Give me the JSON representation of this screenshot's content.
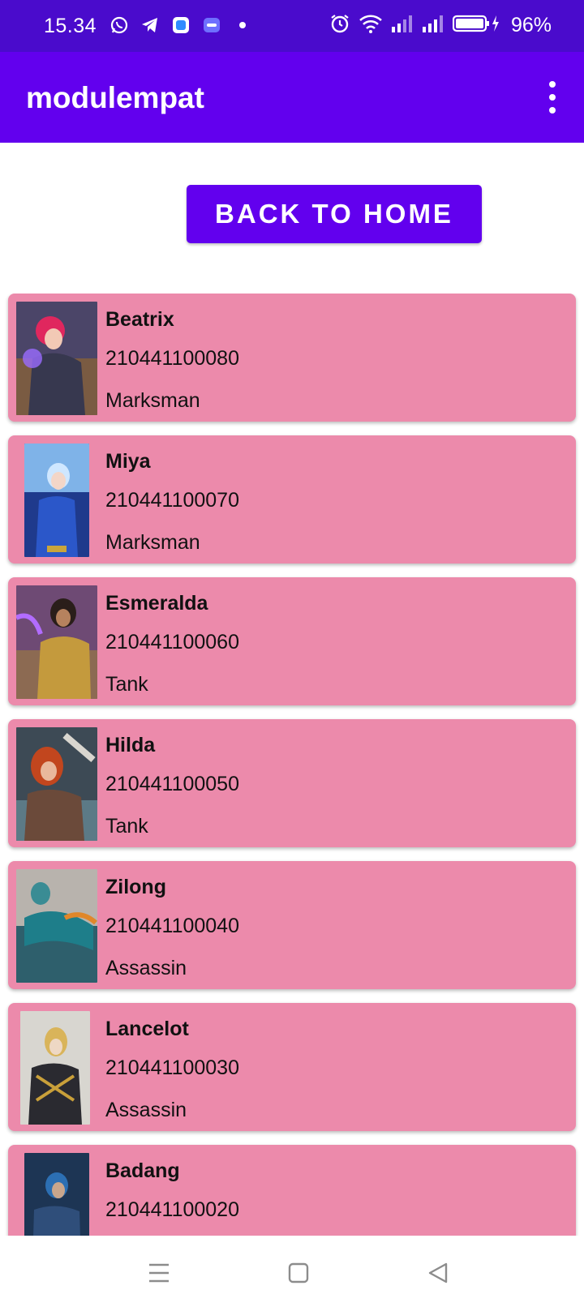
{
  "status_bar": {
    "time": "15.34",
    "battery_percent": "96%",
    "icons_left": [
      "whatsapp-icon",
      "telegram-icon",
      "app-icon",
      "game-icon",
      "dot-icon"
    ],
    "icons_right": [
      "alarm-icon",
      "wifi-icon",
      "signal-icon",
      "signal-icon",
      "battery-icon"
    ]
  },
  "app_bar": {
    "title": "modulempat",
    "menu_icon": "more-vert-icon"
  },
  "back_button": {
    "label": "BACK TO HOME"
  },
  "colors": {
    "status_bar": "#4a0bcc",
    "primary": "#6200ee",
    "card": "#ec8aab"
  },
  "heroes": [
    {
      "name": "Beatrix",
      "nim": "210441100080",
      "role": "Marksman"
    },
    {
      "name": "Miya",
      "nim": "210441100070",
      "role": "Marksman"
    },
    {
      "name": "Esmeralda",
      "nim": "210441100060",
      "role": "Tank"
    },
    {
      "name": "Hilda",
      "nim": "210441100050",
      "role": "Tank"
    },
    {
      "name": "Zilong",
      "nim": "210441100040",
      "role": "Assassin"
    },
    {
      "name": "Lancelot",
      "nim": "210441100030",
      "role": "Assassin"
    },
    {
      "name": "Badang",
      "nim": "210441100020",
      "role": ""
    }
  ],
  "nav_bar": {
    "buttons": [
      "menu-icon",
      "home-icon",
      "back-icon"
    ]
  }
}
